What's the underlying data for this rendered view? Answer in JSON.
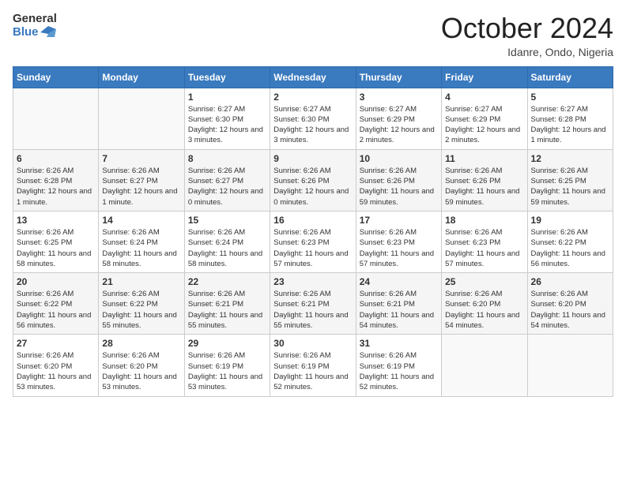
{
  "header": {
    "logo_line1": "General",
    "logo_line2": "Blue",
    "month": "October 2024",
    "location": "Idanre, Ondo, Nigeria"
  },
  "days_of_week": [
    "Sunday",
    "Monday",
    "Tuesday",
    "Wednesday",
    "Thursday",
    "Friday",
    "Saturday"
  ],
  "weeks": [
    [
      {
        "day": "",
        "sunrise": "",
        "sunset": "",
        "daylight": ""
      },
      {
        "day": "",
        "sunrise": "",
        "sunset": "",
        "daylight": ""
      },
      {
        "day": "1",
        "sunrise": "Sunrise: 6:27 AM",
        "sunset": "Sunset: 6:30 PM",
        "daylight": "Daylight: 12 hours and 3 minutes."
      },
      {
        "day": "2",
        "sunrise": "Sunrise: 6:27 AM",
        "sunset": "Sunset: 6:30 PM",
        "daylight": "Daylight: 12 hours and 3 minutes."
      },
      {
        "day": "3",
        "sunrise": "Sunrise: 6:27 AM",
        "sunset": "Sunset: 6:29 PM",
        "daylight": "Daylight: 12 hours and 2 minutes."
      },
      {
        "day": "4",
        "sunrise": "Sunrise: 6:27 AM",
        "sunset": "Sunset: 6:29 PM",
        "daylight": "Daylight: 12 hours and 2 minutes."
      },
      {
        "day": "5",
        "sunrise": "Sunrise: 6:27 AM",
        "sunset": "Sunset: 6:28 PM",
        "daylight": "Daylight: 12 hours and 1 minute."
      }
    ],
    [
      {
        "day": "6",
        "sunrise": "Sunrise: 6:26 AM",
        "sunset": "Sunset: 6:28 PM",
        "daylight": "Daylight: 12 hours and 1 minute."
      },
      {
        "day": "7",
        "sunrise": "Sunrise: 6:26 AM",
        "sunset": "Sunset: 6:27 PM",
        "daylight": "Daylight: 12 hours and 1 minute."
      },
      {
        "day": "8",
        "sunrise": "Sunrise: 6:26 AM",
        "sunset": "Sunset: 6:27 PM",
        "daylight": "Daylight: 12 hours and 0 minutes."
      },
      {
        "day": "9",
        "sunrise": "Sunrise: 6:26 AM",
        "sunset": "Sunset: 6:26 PM",
        "daylight": "Daylight: 12 hours and 0 minutes."
      },
      {
        "day": "10",
        "sunrise": "Sunrise: 6:26 AM",
        "sunset": "Sunset: 6:26 PM",
        "daylight": "Daylight: 11 hours and 59 minutes."
      },
      {
        "day": "11",
        "sunrise": "Sunrise: 6:26 AM",
        "sunset": "Sunset: 6:26 PM",
        "daylight": "Daylight: 11 hours and 59 minutes."
      },
      {
        "day": "12",
        "sunrise": "Sunrise: 6:26 AM",
        "sunset": "Sunset: 6:25 PM",
        "daylight": "Daylight: 11 hours and 59 minutes."
      }
    ],
    [
      {
        "day": "13",
        "sunrise": "Sunrise: 6:26 AM",
        "sunset": "Sunset: 6:25 PM",
        "daylight": "Daylight: 11 hours and 58 minutes."
      },
      {
        "day": "14",
        "sunrise": "Sunrise: 6:26 AM",
        "sunset": "Sunset: 6:24 PM",
        "daylight": "Daylight: 11 hours and 58 minutes."
      },
      {
        "day": "15",
        "sunrise": "Sunrise: 6:26 AM",
        "sunset": "Sunset: 6:24 PM",
        "daylight": "Daylight: 11 hours and 58 minutes."
      },
      {
        "day": "16",
        "sunrise": "Sunrise: 6:26 AM",
        "sunset": "Sunset: 6:23 PM",
        "daylight": "Daylight: 11 hours and 57 minutes."
      },
      {
        "day": "17",
        "sunrise": "Sunrise: 6:26 AM",
        "sunset": "Sunset: 6:23 PM",
        "daylight": "Daylight: 11 hours and 57 minutes."
      },
      {
        "day": "18",
        "sunrise": "Sunrise: 6:26 AM",
        "sunset": "Sunset: 6:23 PM",
        "daylight": "Daylight: 11 hours and 57 minutes."
      },
      {
        "day": "19",
        "sunrise": "Sunrise: 6:26 AM",
        "sunset": "Sunset: 6:22 PM",
        "daylight": "Daylight: 11 hours and 56 minutes."
      }
    ],
    [
      {
        "day": "20",
        "sunrise": "Sunrise: 6:26 AM",
        "sunset": "Sunset: 6:22 PM",
        "daylight": "Daylight: 11 hours and 56 minutes."
      },
      {
        "day": "21",
        "sunrise": "Sunrise: 6:26 AM",
        "sunset": "Sunset: 6:22 PM",
        "daylight": "Daylight: 11 hours and 55 minutes."
      },
      {
        "day": "22",
        "sunrise": "Sunrise: 6:26 AM",
        "sunset": "Sunset: 6:21 PM",
        "daylight": "Daylight: 11 hours and 55 minutes."
      },
      {
        "day": "23",
        "sunrise": "Sunrise: 6:26 AM",
        "sunset": "Sunset: 6:21 PM",
        "daylight": "Daylight: 11 hours and 55 minutes."
      },
      {
        "day": "24",
        "sunrise": "Sunrise: 6:26 AM",
        "sunset": "Sunset: 6:21 PM",
        "daylight": "Daylight: 11 hours and 54 minutes."
      },
      {
        "day": "25",
        "sunrise": "Sunrise: 6:26 AM",
        "sunset": "Sunset: 6:20 PM",
        "daylight": "Daylight: 11 hours and 54 minutes."
      },
      {
        "day": "26",
        "sunrise": "Sunrise: 6:26 AM",
        "sunset": "Sunset: 6:20 PM",
        "daylight": "Daylight: 11 hours and 54 minutes."
      }
    ],
    [
      {
        "day": "27",
        "sunrise": "Sunrise: 6:26 AM",
        "sunset": "Sunset: 6:20 PM",
        "daylight": "Daylight: 11 hours and 53 minutes."
      },
      {
        "day": "28",
        "sunrise": "Sunrise: 6:26 AM",
        "sunset": "Sunset: 6:20 PM",
        "daylight": "Daylight: 11 hours and 53 minutes."
      },
      {
        "day": "29",
        "sunrise": "Sunrise: 6:26 AM",
        "sunset": "Sunset: 6:19 PM",
        "daylight": "Daylight: 11 hours and 53 minutes."
      },
      {
        "day": "30",
        "sunrise": "Sunrise: 6:26 AM",
        "sunset": "Sunset: 6:19 PM",
        "daylight": "Daylight: 11 hours and 52 minutes."
      },
      {
        "day": "31",
        "sunrise": "Sunrise: 6:26 AM",
        "sunset": "Sunset: 6:19 PM",
        "daylight": "Daylight: 11 hours and 52 minutes."
      },
      {
        "day": "",
        "sunrise": "",
        "sunset": "",
        "daylight": ""
      },
      {
        "day": "",
        "sunrise": "",
        "sunset": "",
        "daylight": ""
      }
    ]
  ]
}
